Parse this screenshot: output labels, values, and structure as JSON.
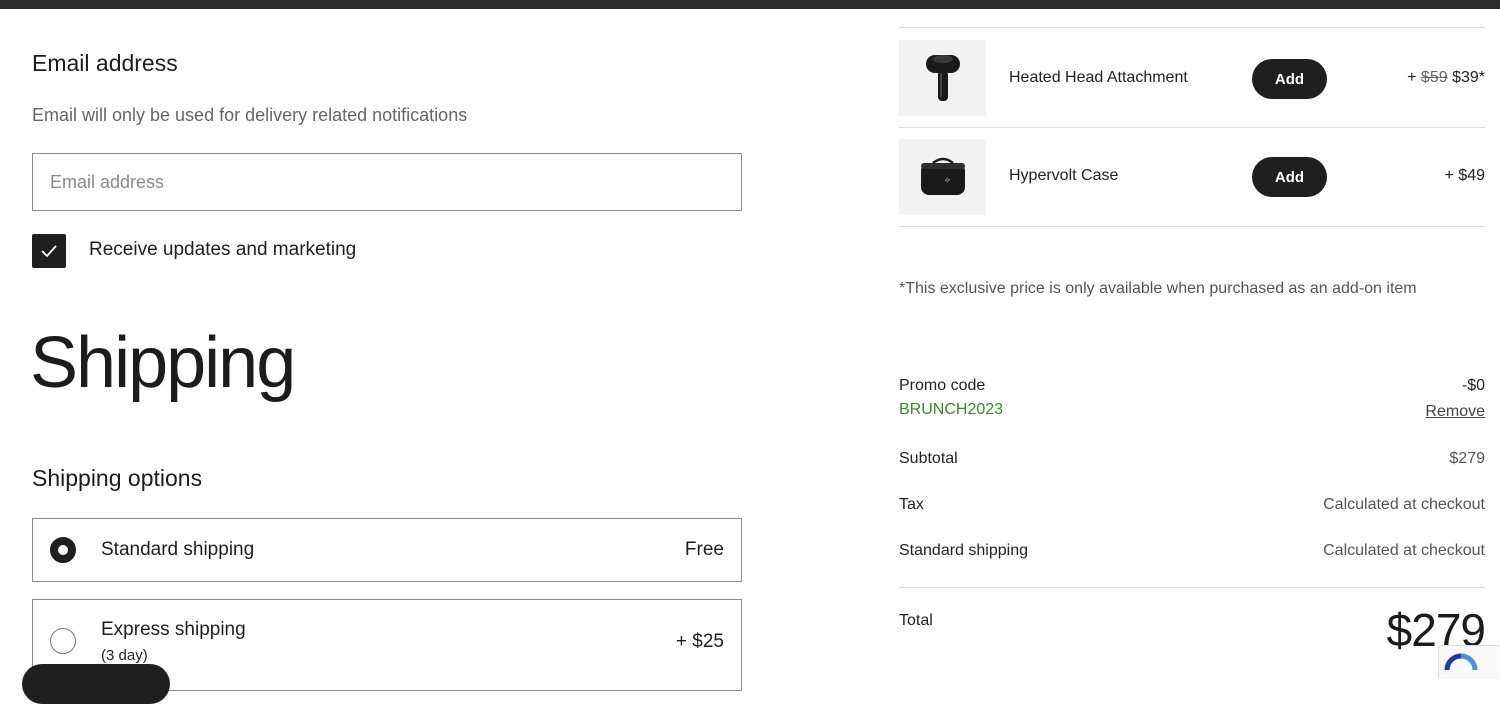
{
  "email_section": {
    "title": "Email address",
    "helper_text": "Email will only be used for delivery related notifications",
    "input_placeholder": "Email address",
    "input_value": "",
    "marketing_checkbox_label": "Receive updates and marketing",
    "marketing_checked": true
  },
  "shipping": {
    "title": "Shipping",
    "options_title": "Shipping options",
    "options": [
      {
        "label": "Standard shipping",
        "sublabel": "",
        "price": "Free",
        "selected": true
      },
      {
        "label": "Express shipping",
        "sublabel": "(3 day)",
        "price": "+ $25",
        "selected": false
      }
    ]
  },
  "addons": [
    {
      "name": "Heated Head Attachment",
      "button_label": "Add",
      "price_prefix": "+ ",
      "original_price": "$59",
      "price": "$39*",
      "icon": "massage-head-icon"
    },
    {
      "name": "Hypervolt Case",
      "button_label": "Add",
      "price_prefix": "+ ",
      "original_price": "",
      "price": "$49",
      "icon": "carry-case-icon"
    }
  ],
  "disclaimer": "*This exclusive price is only available when purchased as an add-on item",
  "summary": {
    "promo_label": "Promo code",
    "promo_code": "BRUNCH2023",
    "promo_value": "-$0",
    "remove_label": "Remove",
    "subtotal_label": "Subtotal",
    "subtotal_value": "$279",
    "tax_label": "Tax",
    "tax_value": "Calculated at checkout",
    "shipping_label": "Standard shipping",
    "shipping_value": "Calculated at checkout",
    "total_label": "Total",
    "total_value": "$279"
  },
  "colors": {
    "promo_green": "#3a8a2a",
    "button_dark": "#1f1f1f"
  }
}
